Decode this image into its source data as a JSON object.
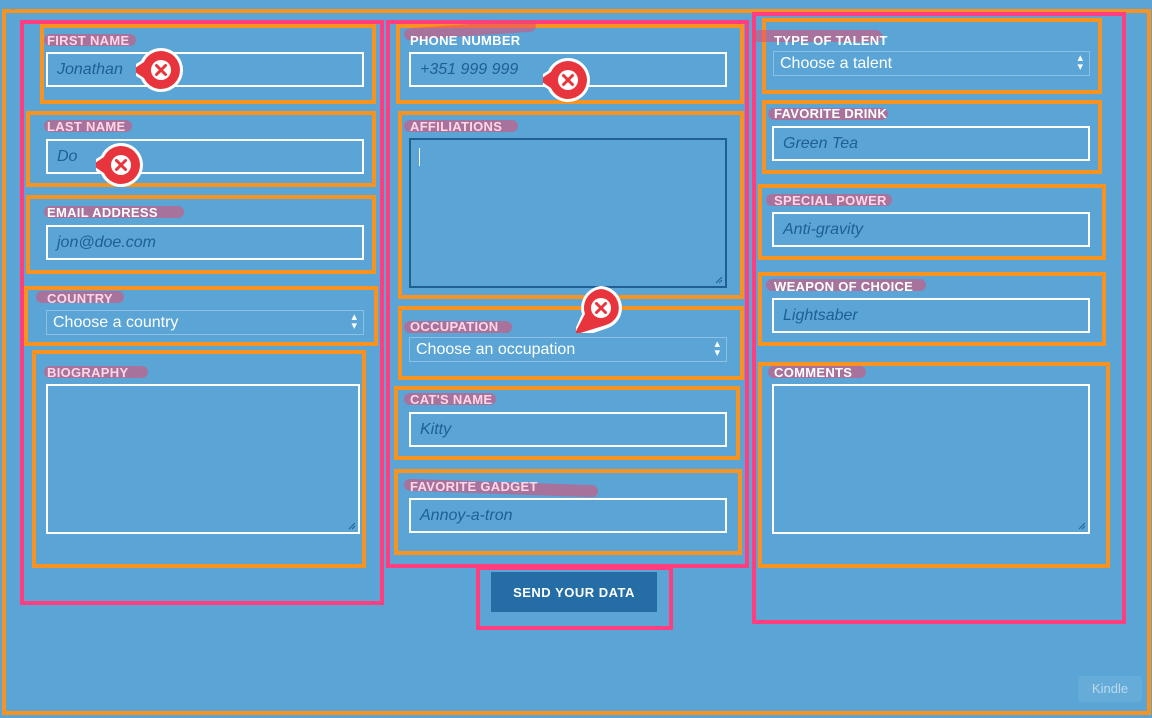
{
  "form": {
    "col1": {
      "first_name": {
        "label": "FIRST NAME",
        "placeholder": "Jonathan"
      },
      "last_name": {
        "label": "LAST NAME",
        "placeholder": "Do"
      },
      "email": {
        "label": "EMAIL ADDRESS",
        "placeholder": "jon@doe.com"
      },
      "country": {
        "label": "COUNTRY",
        "value": "Choose a country"
      },
      "biography": {
        "label": "BIOGRAPHY"
      }
    },
    "col2": {
      "phone": {
        "label": "PHONE NUMBER",
        "placeholder": "+351 999 999"
      },
      "affiliations": {
        "label": "AFFILIATIONS"
      },
      "occupation": {
        "label": "OCCUPATION",
        "value": "Choose an occupation"
      },
      "cat_name": {
        "label": "CAT'S NAME",
        "placeholder": "Kitty"
      },
      "gadget": {
        "label": "FAVORITE GADGET",
        "placeholder": "Annoy-a-tron"
      }
    },
    "col3": {
      "talent": {
        "label": "TYPE OF TALENT",
        "value": "Choose a talent"
      },
      "drink": {
        "label": "FAVORITE DRINK",
        "placeholder": "Green Tea"
      },
      "power": {
        "label": "SPECIAL POWER",
        "placeholder": "Anti-gravity"
      },
      "weapon": {
        "label": "WEAPON OF CHOICE",
        "placeholder": "Lightsaber"
      },
      "comments": {
        "label": "COMMENTS"
      }
    },
    "submit_label": "SEND YOUR DATA"
  },
  "watermark": "Kindle",
  "colors": {
    "background": "#5aa5d6",
    "container_outline": "#f7931e",
    "column_outline": "#ff3d7f",
    "error_badge": "#e8343c",
    "button": "#256ea5"
  },
  "icons": {
    "error": "error-x-icon",
    "select_arrow": "updown-arrow-icon"
  }
}
